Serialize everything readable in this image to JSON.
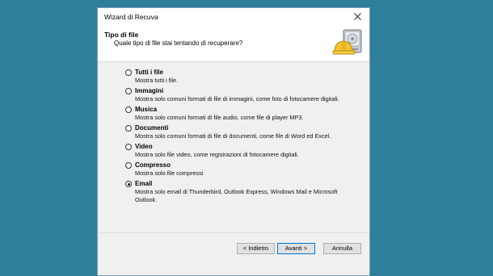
{
  "window": {
    "title": "Wizard di Recuva"
  },
  "header": {
    "title": "Tipo di file",
    "subtitle": "Quale tipo di file stai tentando di recuperare?"
  },
  "options": [
    {
      "label": "Tutti i file",
      "desc": "Mostra tutti i file.",
      "checked": false
    },
    {
      "label": "Immagini",
      "desc": "Mostra solo comuni formati di file di immagini, come foto di fotocamere digitali.",
      "checked": false
    },
    {
      "label": "Musica",
      "desc": "Mostra solo comuni formati di file audio, come file di player MP3.",
      "checked": false
    },
    {
      "label": "Documenti",
      "desc": "Mostra solo comuni formati di file di documenti, come file di Word ed Excel.",
      "checked": false
    },
    {
      "label": "Video",
      "desc": "Mostra solo file video, come registrazioni di fotocamere digitali.",
      "checked": false
    },
    {
      "label": "Compresso",
      "desc": "Mostra solo file compressi",
      "checked": false
    },
    {
      "label": "Email",
      "desc": "Mostra solo email di Thunderbird, Outlook Express, Windows Mail e Microsoft Outlook.",
      "checked": true
    }
  ],
  "buttons": {
    "back": "< Indietro",
    "next": "Avanti >",
    "cancel": "Annulla"
  },
  "colors": {
    "desktop": "#2f7f9a",
    "dialog": "#f0f0f0",
    "primary_border": "#0078d7"
  },
  "icons": {
    "close": "close-icon",
    "logo": "recuva-logo-icon"
  }
}
